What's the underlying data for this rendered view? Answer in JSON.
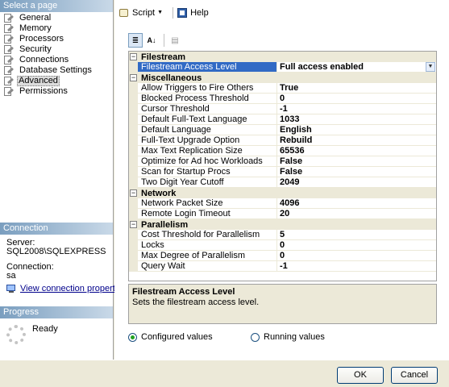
{
  "left": {
    "select_page_header": "Select a page",
    "pages": [
      "General",
      "Memory",
      "Processors",
      "Security",
      "Connections",
      "Database Settings",
      "Advanced",
      "Permissions"
    ],
    "selected_page": "Advanced",
    "connection_header": "Connection",
    "server_label": "Server:",
    "server_value": "SQL2008\\SQLEXPRESS",
    "connection_label": "Connection:",
    "connection_value": "sa",
    "view_connection_link": "View connection properties",
    "progress_header": "Progress",
    "progress_status": "Ready"
  },
  "toolbar": {
    "script_label": "Script",
    "help_label": "Help"
  },
  "grid": {
    "categories": [
      {
        "name": "Filestream",
        "props": [
          {
            "name": "Filestream Access Level",
            "value": "Full access enabled",
            "selected": true
          }
        ]
      },
      {
        "name": "Miscellaneous",
        "props": [
          {
            "name": "Allow Triggers to Fire Others",
            "value": "True"
          },
          {
            "name": "Blocked Process Threshold",
            "value": "0"
          },
          {
            "name": "Cursor Threshold",
            "value": "-1"
          },
          {
            "name": "Default Full-Text Language",
            "value": "1033"
          },
          {
            "name": "Default Language",
            "value": "English"
          },
          {
            "name": "Full-Text Upgrade Option",
            "value": "Rebuild"
          },
          {
            "name": "Max Text Replication Size",
            "value": "65536"
          },
          {
            "name": "Optimize for Ad hoc Workloads",
            "value": "False"
          },
          {
            "name": "Scan for Startup Procs",
            "value": "False"
          },
          {
            "name": "Two Digit Year Cutoff",
            "value": "2049"
          }
        ]
      },
      {
        "name": "Network",
        "props": [
          {
            "name": "Network Packet Size",
            "value": "4096"
          },
          {
            "name": "Remote Login Timeout",
            "value": "20"
          }
        ]
      },
      {
        "name": "Parallelism",
        "props": [
          {
            "name": "Cost Threshold for Parallelism",
            "value": "5"
          },
          {
            "name": "Locks",
            "value": "0"
          },
          {
            "name": "Max Degree of Parallelism",
            "value": "0"
          },
          {
            "name": "Query Wait",
            "value": "-1"
          }
        ]
      }
    ]
  },
  "description": {
    "title": "Filestream Access Level",
    "text": "Sets the filestream access level."
  },
  "radios": {
    "configured_label": "Configured values",
    "running_label": "Running values",
    "selected": "configured"
  },
  "buttons": {
    "ok_label": "OK",
    "cancel_label": "Cancel"
  }
}
